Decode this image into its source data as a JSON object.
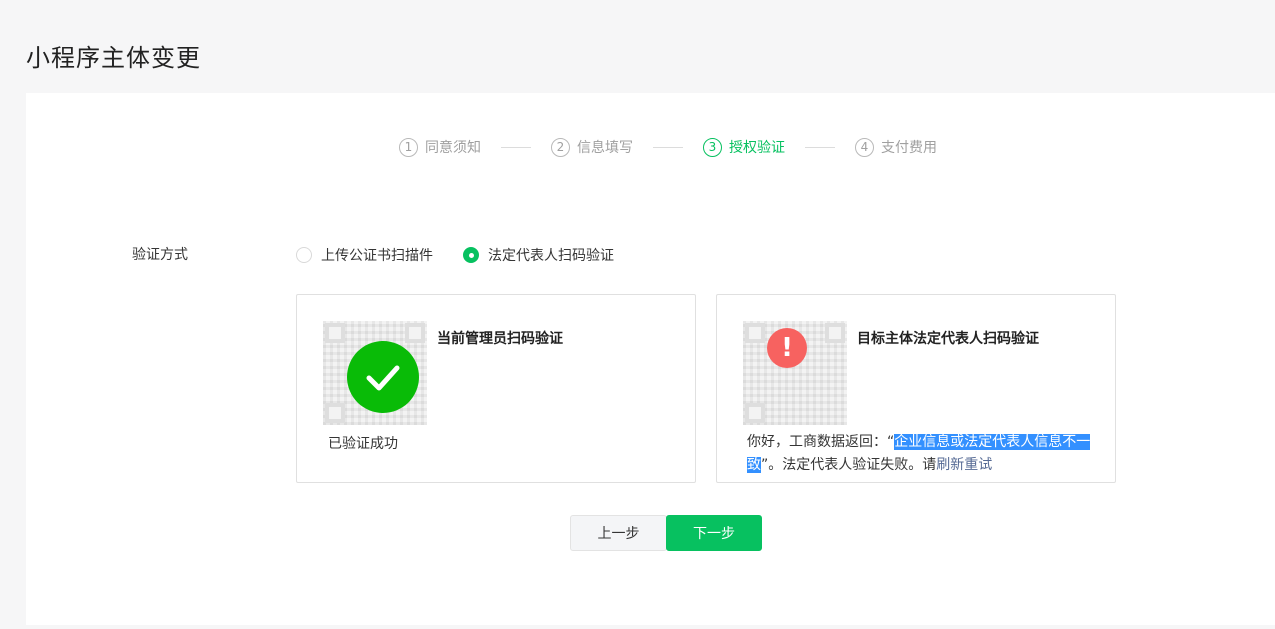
{
  "page": {
    "title": "小程序主体变更"
  },
  "steps": [
    {
      "num": "1",
      "label": "同意须知",
      "active": false
    },
    {
      "num": "2",
      "label": "信息填写",
      "active": false
    },
    {
      "num": "3",
      "label": "授权验证",
      "active": true
    },
    {
      "num": "4",
      "label": "支付费用",
      "active": false
    }
  ],
  "verify": {
    "label": "验证方式",
    "options": [
      {
        "label": "上传公证书扫描件",
        "checked": false
      },
      {
        "label": "法定代表人扫码验证",
        "checked": true
      }
    ]
  },
  "cards": {
    "admin": {
      "title": "当前管理员扫码验证",
      "status": "已验证成功"
    },
    "legal": {
      "title": "目标主体法定代表人扫码验证",
      "msg_prefix": "你好，工商数据返回：“",
      "msg_highlight": "企业信息或法定代表人信息不一致",
      "msg_middle": "”。法定代表人验证失败。请",
      "msg_link": "刷新重试"
    }
  },
  "buttons": {
    "prev": "上一步",
    "next": "下一步"
  },
  "colors": {
    "accent": "#07c160",
    "success": "#09bb07",
    "warn": "#f76260",
    "highlight": "#3390ff",
    "link": "#576b95"
  }
}
